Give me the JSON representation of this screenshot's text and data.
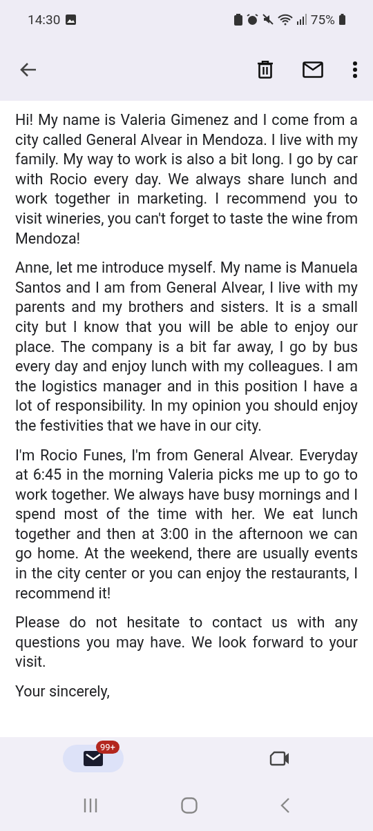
{
  "status_bar": {
    "time": "14:30",
    "battery": "75%"
  },
  "paragraphs": [
    "Hi! My name is Valeria Gimenez and I come from a city called General Alvear in Mendoza. I live with my family. My way to work is also a bit long. I go by car with Rocio every day. We always share lunch and work together in marketing. I recommend you to visit wineries, you can't forget to taste the wine from Mendoza!",
    "Anne, let me introduce myself. My name is Manuela Santos and I am from General Alvear, I live with my parents and my brothers and sisters. It is a small city but I know that you will be able to enjoy our place. The company is a bit far away, I go by bus every day and enjoy lunch with my colleagues. I am the logistics manager and in this position I have a lot of responsibility. In my opinion you should enjoy the festivities that we have in our city.",
    "I'm Rocio Funes, I'm from General Alvear. Everyday at 6:45 in the morning Valeria picks me up to go to work together. We always have busy mornings and I spend most of the time with her. We eat lunch together and then at 3:00 in the afternoon we can go home. At the weekend, there are usually events in the city center or you can enjoy the restaurants, I recommend it!",
    "Please do not hesitate to contact us with any questions you may have. We look forward to your visit.",
    "Your sincerely,"
  ],
  "bottom_tabs": [
    {
      "kind": "mail",
      "selected": true,
      "badge": "99+"
    },
    {
      "kind": "video",
      "selected": false
    }
  ]
}
